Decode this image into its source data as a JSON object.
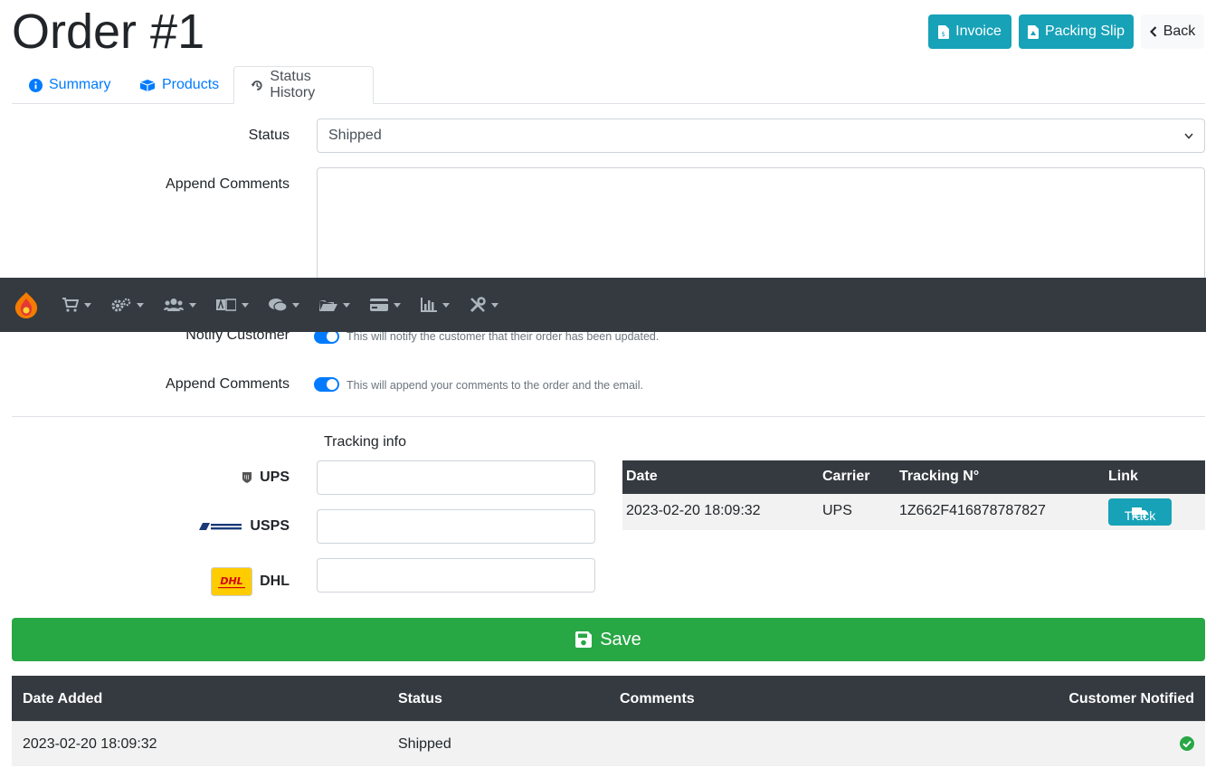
{
  "page": {
    "title": "Order #1"
  },
  "header_buttons": {
    "invoice": "Invoice",
    "packing_slip": "Packing Slip",
    "back": "Back"
  },
  "tabs": [
    {
      "label": "Summary",
      "icon": "info-circle-icon"
    },
    {
      "label": "Products",
      "icon": "boxes-icon"
    },
    {
      "label": "Status History",
      "icon": "history-icon",
      "active": true
    }
  ],
  "form": {
    "status_label": "Status",
    "status_value": "Shipped",
    "append_comments_label": "Append Comments",
    "notify_customer_label": "Notify Customer",
    "notify_help": "This will notify the customer that their order has been updated.",
    "append_label_2": "Append Comments",
    "append_help": "This will append your comments to the order and the email.",
    "tracking_info": "Tracking info",
    "carriers": [
      {
        "name": "UPS"
      },
      {
        "name": "USPS"
      },
      {
        "name": "DHL"
      }
    ],
    "save_label": "Save"
  },
  "tracking_table": {
    "headers": [
      "Date",
      "Carrier",
      "Tracking N°",
      "Link"
    ],
    "rows": [
      {
        "date": "2023-02-20 18:09:32",
        "carrier": "UPS",
        "tracking": "1Z662F416878787827",
        "link": "Track"
      }
    ]
  },
  "history_table": {
    "headers": [
      "Date Added",
      "Status",
      "Comments",
      "Customer Notified"
    ],
    "rows": [
      {
        "date": "2023-02-20 18:09:32",
        "status": "Shipped",
        "comments": "",
        "notified": true
      }
    ]
  },
  "navbar": {
    "items": [
      "cart-icon",
      "cogs-icon",
      "users-icon",
      "language-icon",
      "comments-icon",
      "folder-icon",
      "credit-card-icon",
      "chart-icon",
      "tools-icon"
    ]
  },
  "colors": {
    "info": "#17a2b8",
    "primary": "#007bff",
    "success": "#28a745",
    "dark": "#343a40"
  }
}
